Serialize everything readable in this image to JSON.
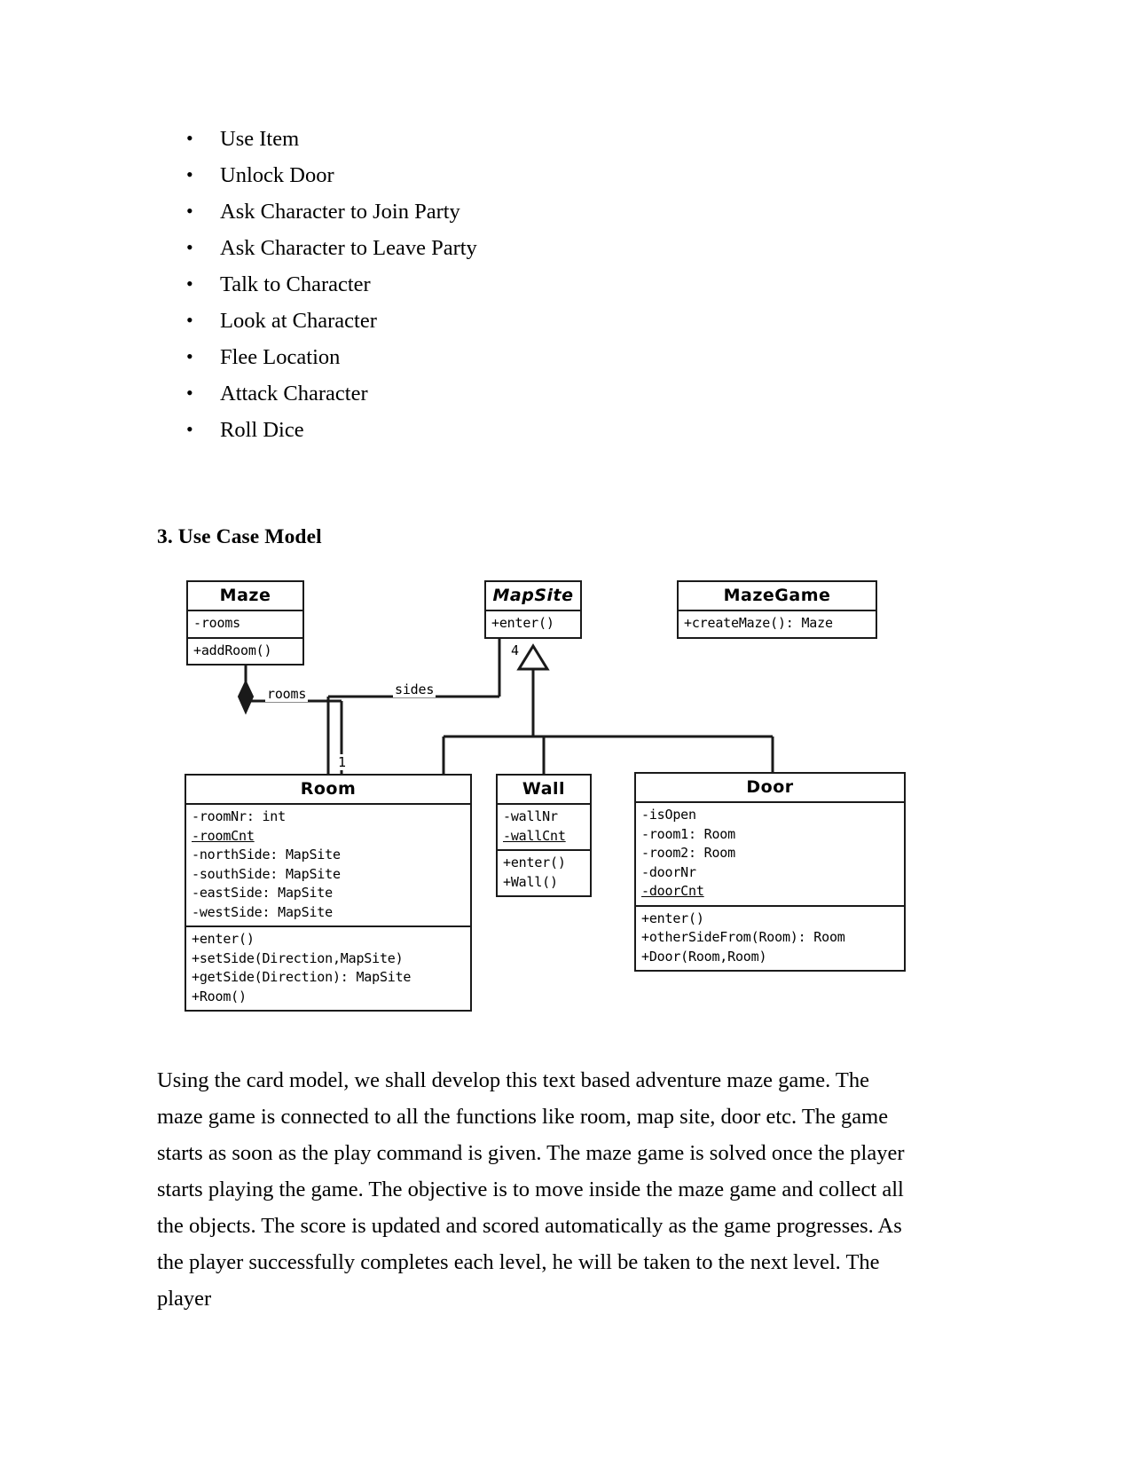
{
  "bullets": [
    "Use Item",
    "Unlock Door",
    "Ask Character to Join Party",
    "Ask Character to Leave Party",
    "Talk to Character",
    "Look at Character",
    "Flee Location",
    "Attack Character",
    "Roll Dice"
  ],
  "heading": "3. Use Case Model",
  "diagram": {
    "classes": {
      "maze": {
        "name": "Maze",
        "attributes": [
          "-rooms"
        ],
        "operations": [
          "+addRoom()"
        ]
      },
      "mapsite": {
        "name": "MapSite",
        "abstract": true,
        "operations": [
          "+enter()"
        ]
      },
      "mazegame": {
        "name": "MazeGame",
        "operations": [
          "+createMaze(): Maze"
        ]
      },
      "room": {
        "name": "Room",
        "attributes": [
          "-roomNr: int",
          "-roomCnt",
          "-northSide: MapSite",
          "-southSide: MapSite",
          "-eastSide: MapSite",
          "-westSide: MapSite"
        ],
        "static_attributes": [
          "-roomCnt"
        ],
        "operations": [
          "+enter()",
          "+setSide(Direction,MapSite)",
          "+getSide(Direction): MapSite",
          "+Room()"
        ]
      },
      "wall": {
        "name": "Wall",
        "attributes": [
          "-wallNr",
          "-wallCnt"
        ],
        "static_attributes": [
          "-wallCnt"
        ],
        "operations": [
          "+enter()",
          "+Wall()"
        ]
      },
      "door": {
        "name": "Door",
        "attributes": [
          "-isOpen",
          "-room1: Room",
          "-room2: Room",
          "-doorNr",
          "-doorCnt"
        ],
        "static_attributes": [
          "-doorCnt"
        ],
        "operations": [
          "+enter()",
          "+otherSideFrom(Room): Room",
          "+Door(Room,Room)"
        ]
      }
    },
    "edges": {
      "rooms_label": "rooms",
      "rooms_multiplicity": "1",
      "sides_label": "sides",
      "sides_multiplicity": "4"
    },
    "colors": {
      "line": "#1a1a1a",
      "fill": "#ffffff"
    }
  },
  "paragraph": "Using the card model, we shall develop this text based adventure maze game.  The maze game is connected to all the functions like room, map site, door etc. The game starts as soon as the play command is given. The maze game is solved once the player starts playing the game. The objective is to move inside the maze game and collect all the objects. The score is updated and scored automatically as the game progresses. As the player successfully completes each level, he will be taken to the next level. The player"
}
